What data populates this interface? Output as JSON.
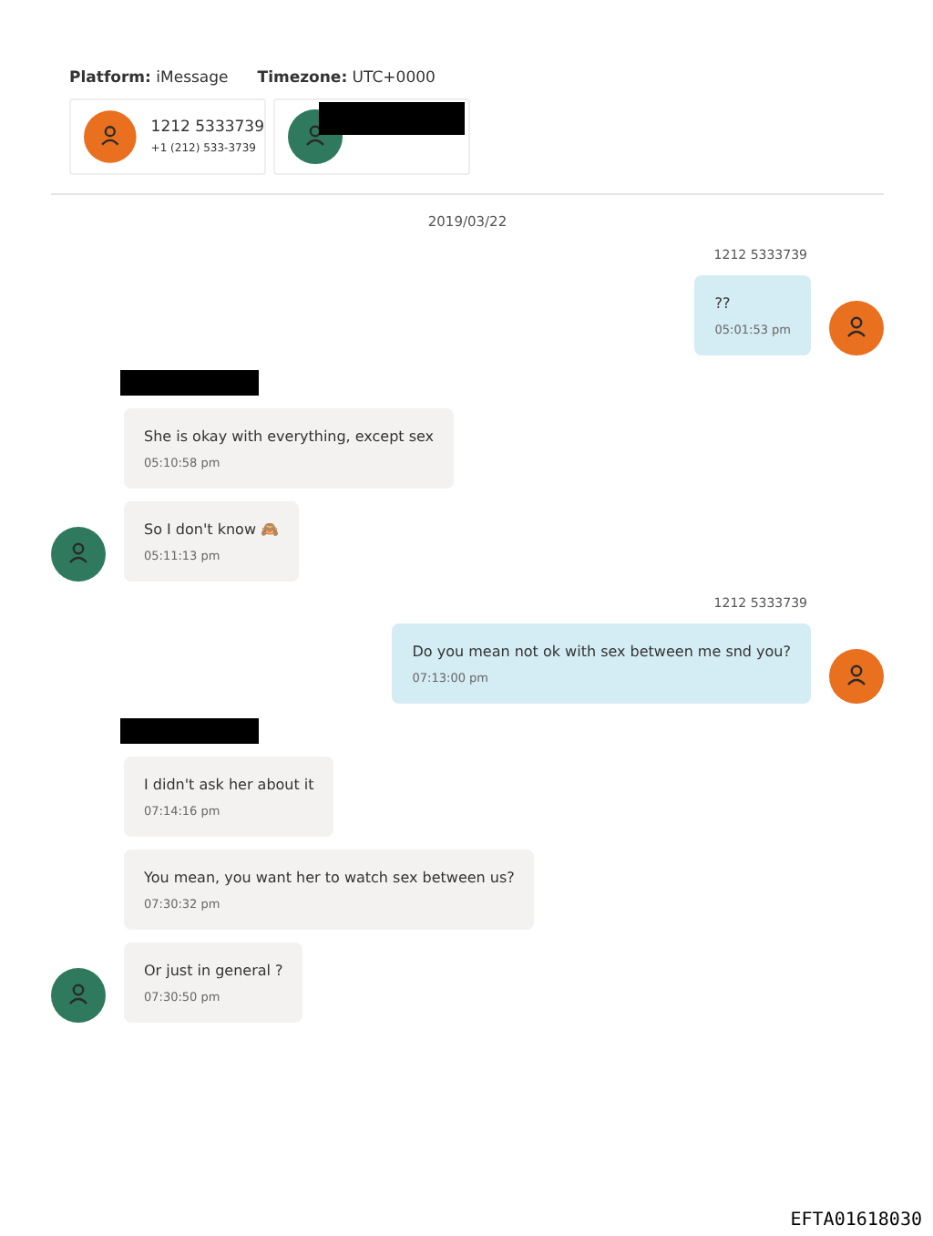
{
  "header": {
    "platform_label": "Platform:",
    "platform": "iMessage",
    "timezone_label": "Timezone:",
    "timezone": "UTC+0000"
  },
  "participants": [
    {
      "color": "#e8701f",
      "name": "1212 5333739",
      "number": "+1 (212) 533-3739",
      "redacted": false
    },
    {
      "color": "#2f7a5f",
      "redacted": true
    }
  ],
  "date": "2019/03/22",
  "groups": [
    {
      "kind": "outgoing",
      "sender": "1212 5333739",
      "redacted": false,
      "color": "#e8701f",
      "messages": [
        {
          "text": "??",
          "time": "05:01:53 pm"
        }
      ]
    },
    {
      "kind": "incoming",
      "redacted": true,
      "color": "#2f7a5f",
      "messages": [
        {
          "text": "She is okay with everything, except sex",
          "time": "05:10:58 pm"
        },
        {
          "text": "So I don't know 🙈",
          "time": "05:11:13 pm"
        }
      ]
    },
    {
      "kind": "outgoing",
      "sender": "1212 5333739",
      "redacted": false,
      "color": "#e8701f",
      "messages": [
        {
          "text": "Do you mean not ok with sex between me snd you?",
          "time": "07:13:00 pm"
        }
      ]
    },
    {
      "kind": "incoming",
      "redacted": true,
      "color": "#2f7a5f",
      "messages": [
        {
          "text": "I didn't ask her about it",
          "time": "07:14:16 pm"
        },
        {
          "text": "You mean, you want her to watch sex between us?",
          "time": "07:30:32 pm"
        },
        {
          "text": "Or just in general ?",
          "time": "07:30:50 pm"
        }
      ]
    }
  ],
  "stamp": "EFTA01618030"
}
